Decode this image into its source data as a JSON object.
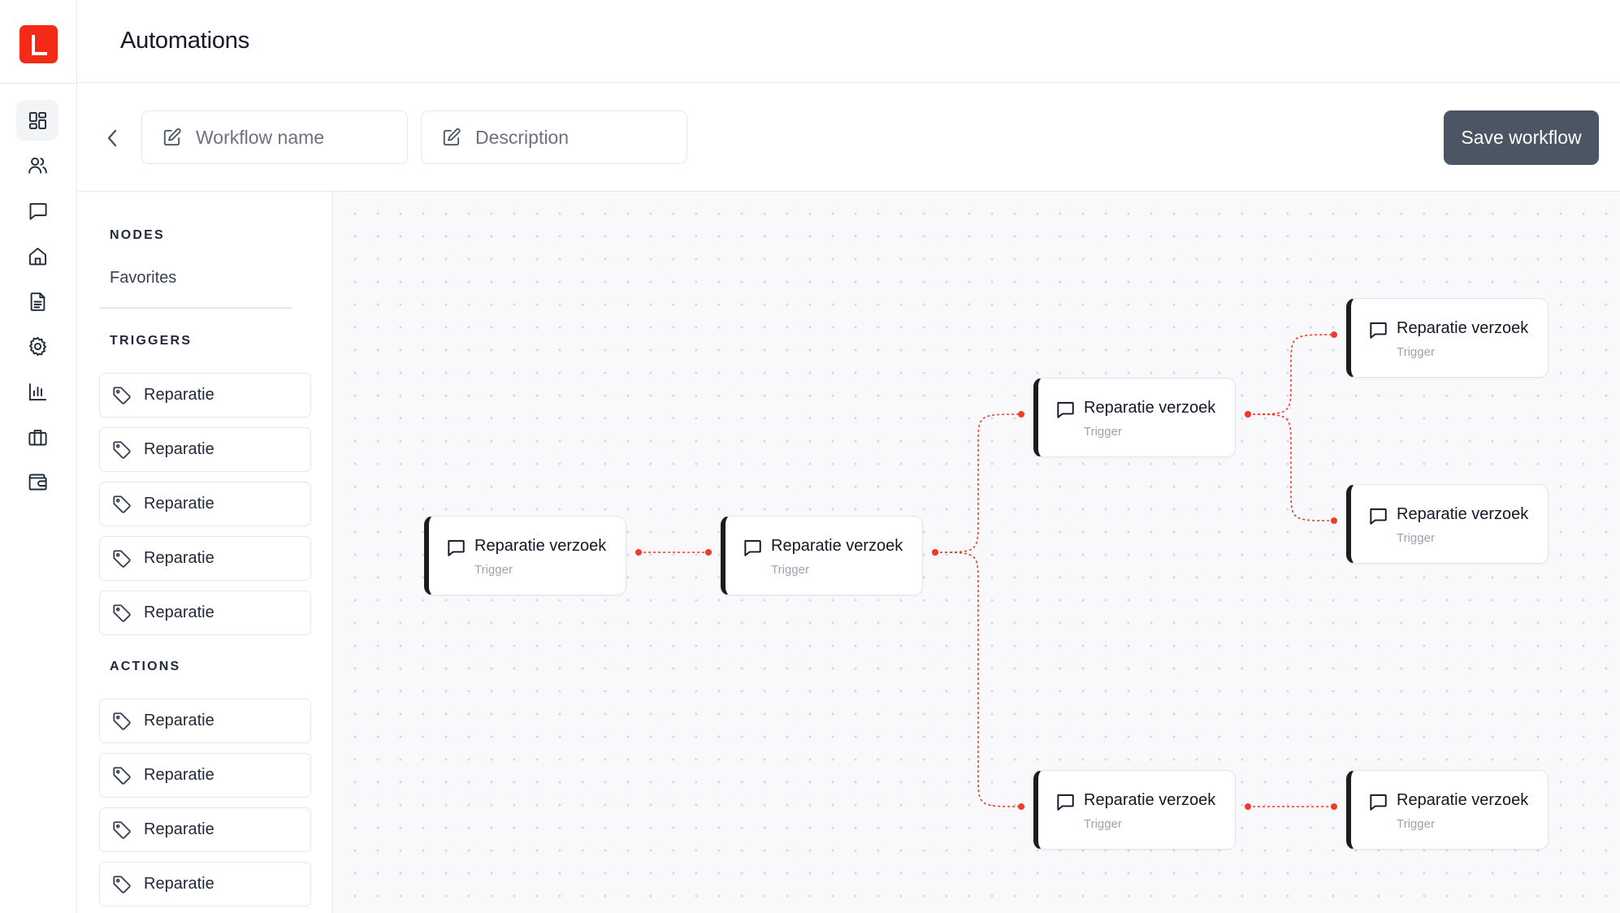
{
  "app": {
    "logo_icon": "logo-l-icon",
    "brand_color": "#f22a17",
    "page_title": "Automations"
  },
  "rail": {
    "items": [
      {
        "icon": "dashboard-grid-icon",
        "active": true
      },
      {
        "icon": "users-icon"
      },
      {
        "icon": "chat-bubble-icon"
      },
      {
        "icon": "home-icon"
      },
      {
        "icon": "document-icon"
      },
      {
        "icon": "gear-icon"
      },
      {
        "icon": "bar-chart-icon"
      },
      {
        "icon": "briefcase-icon"
      },
      {
        "icon": "wallet-icon"
      }
    ]
  },
  "toolbar": {
    "back_icon": "chevron-left-icon",
    "workflow_name": {
      "value": "",
      "placeholder": "Workflow name",
      "icon": "edit-pencil-icon"
    },
    "description": {
      "value": "",
      "placeholder": "Description",
      "icon": "edit-pencil-icon"
    },
    "save_label": "Save workflow",
    "save_color": "#4b5563"
  },
  "palette": {
    "nodes_title": "NODES",
    "favorites_label": "Favorites",
    "triggers_title": "TRIGGERS",
    "triggers": [
      {
        "label": "Reparatie",
        "icon": "tag-icon"
      },
      {
        "label": "Reparatie",
        "icon": "tag-icon"
      },
      {
        "label": "Reparatie",
        "icon": "tag-icon"
      },
      {
        "label": "Reparatie",
        "icon": "tag-icon"
      },
      {
        "label": "Reparatie",
        "icon": "tag-icon"
      }
    ],
    "actions_title": "ACTIONS",
    "actions": [
      {
        "label": "Reparatie",
        "icon": "tag-icon"
      },
      {
        "label": "Reparatie",
        "icon": "tag-icon"
      },
      {
        "label": "Reparatie",
        "icon": "tag-icon"
      },
      {
        "label": "Reparatie",
        "icon": "tag-icon"
      }
    ]
  },
  "workflow": {
    "edge_color": "#f03a2a",
    "node_accent": "#1c1c1e",
    "nodes": [
      {
        "id": "n1",
        "title": "Reparatie verzoek",
        "subtitle": "Trigger",
        "icon": "chat-bubble-icon"
      },
      {
        "id": "n2",
        "title": "Reparatie verzoek",
        "subtitle": "Trigger",
        "icon": "chat-bubble-icon"
      },
      {
        "id": "n3",
        "title": "Reparatie verzoek",
        "subtitle": "Trigger",
        "icon": "chat-bubble-icon"
      },
      {
        "id": "n4",
        "title": "Reparatie verzoek",
        "subtitle": "Trigger",
        "icon": "chat-bubble-icon"
      },
      {
        "id": "n5",
        "title": "Reparatie verzoek",
        "subtitle": "Trigger",
        "icon": "chat-bubble-icon"
      },
      {
        "id": "n6",
        "title": "Reparatie verzoek",
        "subtitle": "Trigger",
        "icon": "chat-bubble-icon"
      },
      {
        "id": "n7",
        "title": "Reparatie verzoek",
        "subtitle": "Trigger",
        "icon": "chat-bubble-icon"
      }
    ],
    "edges": [
      {
        "from": "n1",
        "to": "n2"
      },
      {
        "from": "n2",
        "to": "n3"
      },
      {
        "from": "n2",
        "to": "n6"
      },
      {
        "from": "n3",
        "to": "n4"
      },
      {
        "from": "n3",
        "to": "n5"
      },
      {
        "from": "n6",
        "to": "n7"
      }
    ]
  }
}
